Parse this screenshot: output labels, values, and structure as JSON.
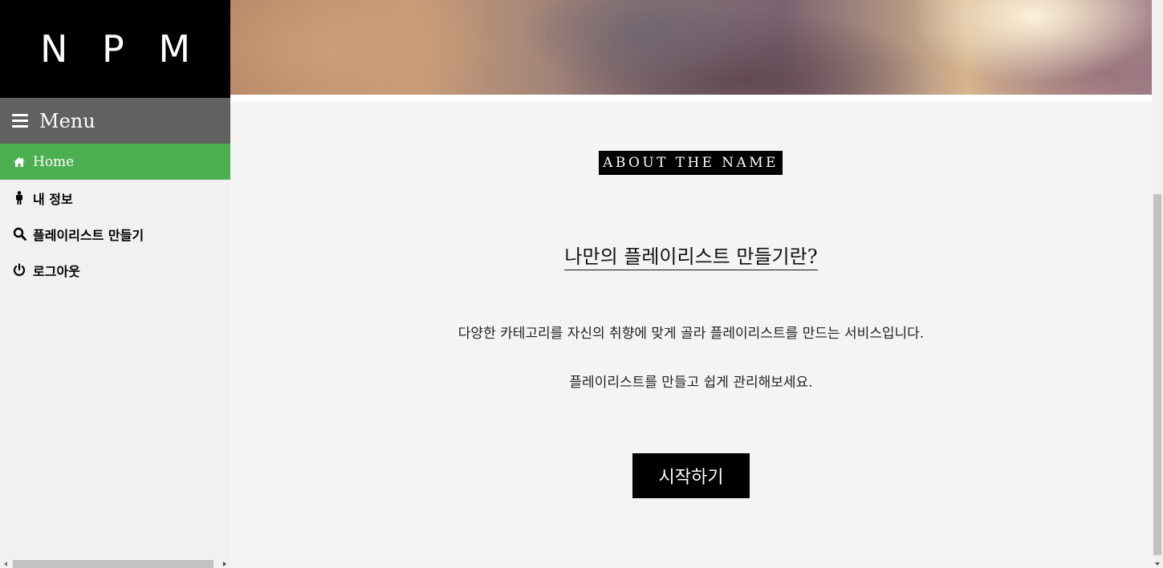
{
  "sidebar": {
    "logo": "N P M",
    "menu_label": "Menu",
    "items": [
      {
        "label": "Home",
        "icon": "home-icon",
        "active": true
      },
      {
        "label": "내 정보",
        "icon": "person-icon",
        "active": false
      },
      {
        "label": "플레이리스트 만들기",
        "icon": "search-icon",
        "active": false
      },
      {
        "label": "로그아웃",
        "icon": "power-icon",
        "active": false
      }
    ]
  },
  "main": {
    "badge": "ABOUT THE NAME",
    "heading": "나만의 플레이리스트 만들기란?",
    "description_line1": "다양한 카테고리를 자신의 취향에 맞게 골라 플레이리스트를 만드는 서비스입니다.",
    "description_line2": "플레이리스트를 만들고 쉽게 관리해보세요.",
    "start_button": "시작하기"
  },
  "colors": {
    "active_green": "#4caf50",
    "menu_gray": "#616161",
    "logo_bg": "#000000"
  }
}
